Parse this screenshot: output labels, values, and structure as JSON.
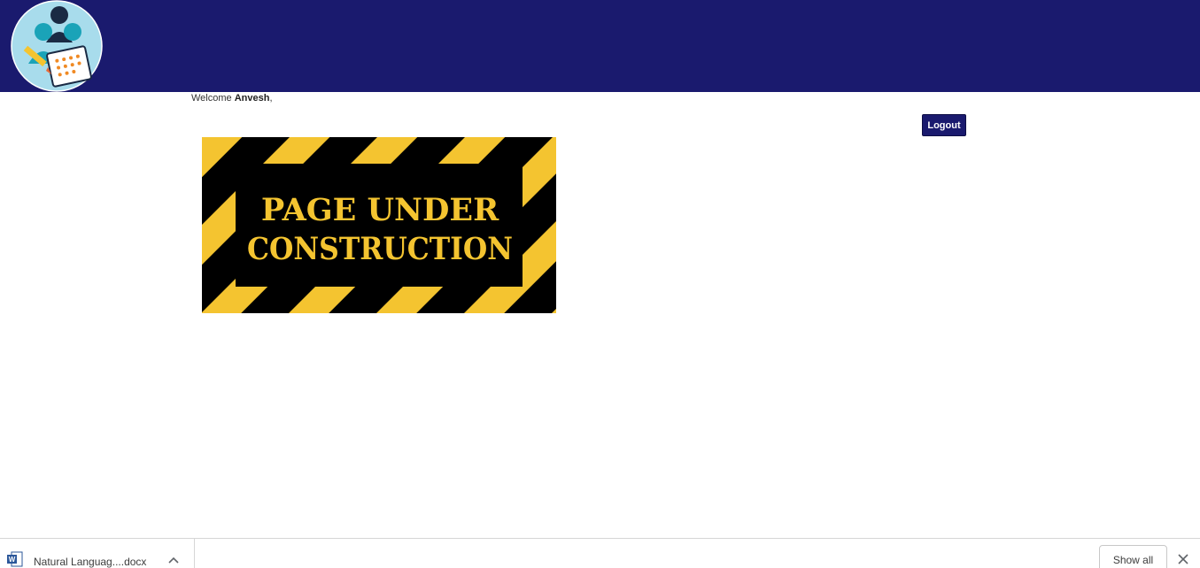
{
  "header": {
    "logo_icon": "survey-people-logo-icon",
    "background_color": "#1a1a6e"
  },
  "welcome": {
    "prefix": "Welcome ",
    "username": "Anvesh",
    "suffix": ","
  },
  "logout_button": {
    "label": "Logout"
  },
  "banner": {
    "line1": "PAGE UNDER",
    "line2": "CONSTRUCTION",
    "stripe_color": "#f4c430",
    "background_color": "#000000"
  },
  "download_bar": {
    "file_icon": "word-doc-icon",
    "file_name": "Natural Languag....docx",
    "chevron_icon": "chevron-up-icon",
    "show_all_label": "Show all",
    "close_icon": "close-icon"
  }
}
